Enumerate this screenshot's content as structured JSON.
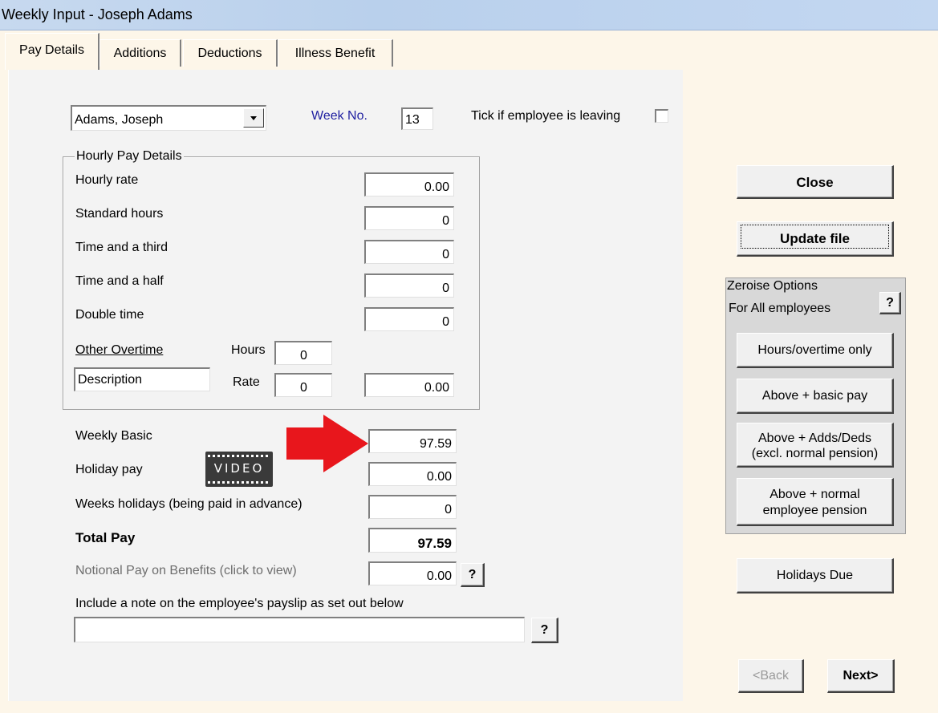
{
  "window": {
    "title": "Weekly Input - Joseph Adams"
  },
  "tabs": [
    {
      "label": "Pay Details"
    },
    {
      "label": "Additions"
    },
    {
      "label": "Deductions"
    },
    {
      "label": "Illness Benefit"
    }
  ],
  "employee_select": {
    "value": "Adams, Joseph"
  },
  "week": {
    "label": "Week No.",
    "value": "13"
  },
  "leaving": {
    "label": "Tick if employee is leaving",
    "checked": false
  },
  "hourly": {
    "legend": "Hourly Pay Details",
    "hourly_rate": {
      "label": "Hourly rate",
      "value": "0.00"
    },
    "standard_hours": {
      "label": "Standard hours",
      "value": "0"
    },
    "time_third": {
      "label": "Time and a third",
      "value": "0"
    },
    "time_half": {
      "label": "Time and a half",
      "value": "0"
    },
    "double_time": {
      "label": "Double time",
      "value": "0"
    },
    "other_overtime": {
      "label": "Other Overtime",
      "hours_label": "Hours",
      "hours_value": "0",
      "description": "Description",
      "rate_label": "Rate",
      "rate_value": "0",
      "amount": "0.00"
    }
  },
  "weekly_basic": {
    "label": "Weekly Basic",
    "value": "97.59"
  },
  "video_label": "VIDEO",
  "holiday_pay": {
    "label": "Holiday pay",
    "value": "0.00"
  },
  "weeks_holidays": {
    "label": "Weeks holidays (being paid in advance)",
    "value": "0"
  },
  "total_pay": {
    "label": "Total Pay",
    "value": "97.59"
  },
  "notional": {
    "label": "Notional Pay on Benefits (click to view)",
    "value": "0.00",
    "help": "?"
  },
  "note": {
    "label": "Include a note on the employee's payslip as set out below",
    "value": "",
    "help": "?"
  },
  "buttons": {
    "close": "Close",
    "update": "Update file",
    "holidays_due": "Holidays Due",
    "back": "<Back",
    "next": "Next>"
  },
  "zeroise": {
    "legend": "Zeroise Options",
    "subtitle": "For All employees",
    "help": "?",
    "opt1": "Hours/overtime only",
    "opt2": "Above + basic pay",
    "opt3_line1": "Above + Adds/Deds",
    "opt3_line2": "(excl. normal pension)",
    "opt4_line1": "Above + normal",
    "opt4_line2": "employee pension"
  },
  "colors": {
    "week_label": "#1f1fa0",
    "arrow": "#e8161c",
    "notional_label": "#6d6d6d"
  }
}
